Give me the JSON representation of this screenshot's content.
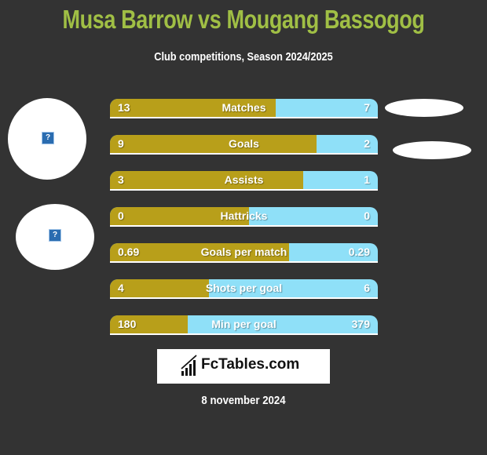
{
  "header": {
    "title": "Musa Barrow vs Mougang Bassogog",
    "subtitle": "Club competitions, Season 2024/2025"
  },
  "players": {
    "left": {
      "name": "Musa Barrow",
      "avatar_icon": "broken-image-icon"
    },
    "right": {
      "name": "Mougang Bassogog"
    }
  },
  "colors": {
    "left": "#b89f1a",
    "right": "#8fe0f8",
    "title": "#a0bf45",
    "background": "#333333"
  },
  "stats": [
    {
      "label": "Matches",
      "left": "13",
      "right": "7",
      "left_share": 0.62
    },
    {
      "label": "Goals",
      "left": "9",
      "right": "2",
      "left_share": 0.77
    },
    {
      "label": "Assists",
      "left": "3",
      "right": "1",
      "left_share": 0.72
    },
    {
      "label": "Hattricks",
      "left": "0",
      "right": "0",
      "left_share": 0.52
    },
    {
      "label": "Goals per match",
      "left": "0.69",
      "right": "0.29",
      "left_share": 0.67
    },
    {
      "label": "Shots per goal",
      "left": "4",
      "right": "6",
      "left_share": 0.37
    },
    {
      "label": "Min per goal",
      "left": "180",
      "right": "379",
      "left_share": 0.29
    }
  ],
  "footer": {
    "logo_text": "FcTables.com",
    "date": "8 november 2024"
  }
}
